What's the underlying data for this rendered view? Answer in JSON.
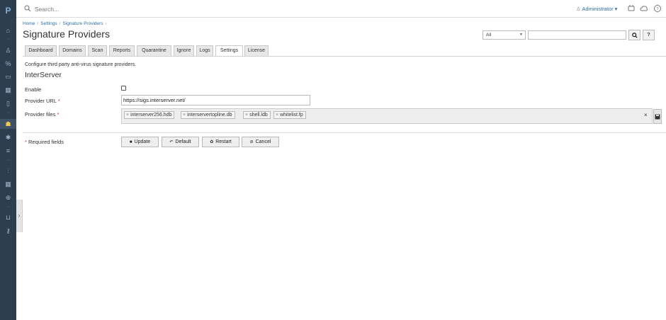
{
  "app": {
    "logo": "P"
  },
  "topbar": {
    "search_placeholder": "Search...",
    "user_label": "Administrator ▾"
  },
  "breadcrumb": [
    "Home",
    "Settings",
    "Signature Providers"
  ],
  "page_title": "Signature Providers",
  "filter": {
    "scope_value": "All",
    "query_value": ""
  },
  "tabs": [
    "Dashboard",
    "Domains",
    "Scan",
    "Reports",
    "Quarantine",
    "Ignore",
    "Logs",
    "Settings",
    "License"
  ],
  "active_tab": "Settings",
  "description": "Configure third party anti-virus signature providers.",
  "provider": {
    "name": "InterServer",
    "enable_label": "Enable",
    "enabled": false,
    "url_label": "Provider URL",
    "url_value": "https://sigs.interserver.net/",
    "files_label": "Provider files",
    "files": [
      "interserver256.hdb",
      "interservertopline.db",
      "shell.ldb",
      "whitelist.fp"
    ]
  },
  "required_star": "*",
  "required_note": "Required fields",
  "buttons": {
    "update": "Update",
    "default": "Default",
    "restart": "Restart",
    "cancel": "Cancel"
  },
  "colors": {
    "rail": "#2d3e4f",
    "link": "#2c6fa8",
    "required": "#c0392b",
    "rail_active_icon": "#f2c94c"
  }
}
